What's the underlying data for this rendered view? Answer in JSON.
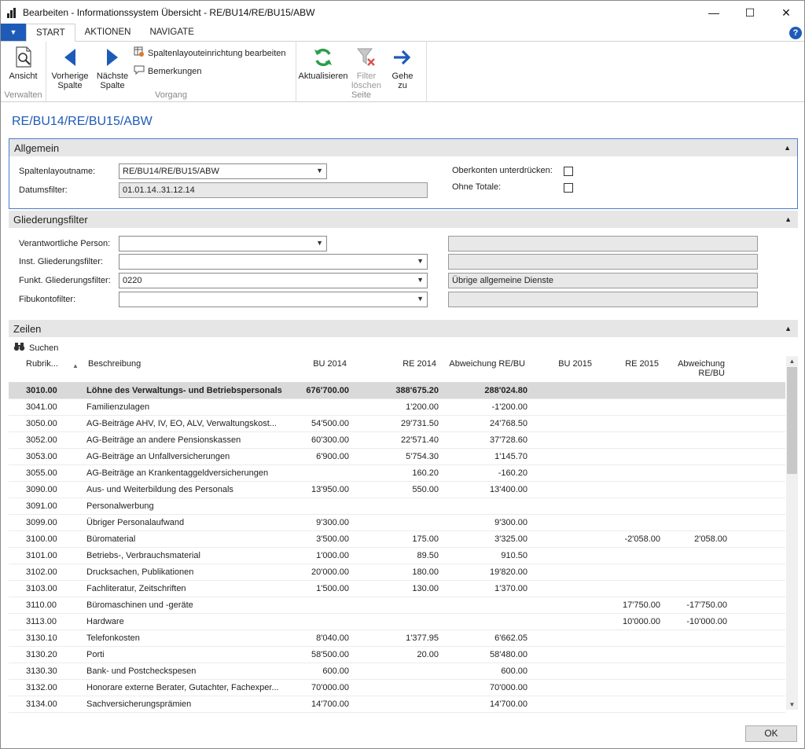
{
  "window": {
    "title": "Bearbeiten - Informationssystem Übersicht - RE/BU14/RE/BU15/ABW",
    "minimize": "—",
    "maximize": "☐",
    "close": "✕"
  },
  "ribbon": {
    "tabs": [
      "START",
      "AKTIONEN",
      "NAVIGATE"
    ],
    "help": "?",
    "groups": {
      "verwalten": {
        "label": "Verwalten",
        "ansicht": "Ansicht"
      },
      "vorgang": {
        "label": "Vorgang",
        "vorherige_l1": "Vorherige",
        "vorherige_l2": "Spalte",
        "naechste_l1": "Nächste",
        "naechste_l2": "Spalte",
        "spaltenlayout": "Spaltenlayouteinrichtung bearbeiten",
        "bemerkungen": "Bemerkungen"
      },
      "seite": {
        "label": "Seite",
        "aktualisieren": "Aktualisieren",
        "filter_l1": "Filter",
        "filter_l2": "löschen",
        "gehe_l1": "Gehe",
        "gehe_l2": "zu"
      }
    },
    "colors": {
      "accent": "#1e5bb8",
      "refresh": "#2a9d4a",
      "filter_x": "#d9534f"
    }
  },
  "page": {
    "title": "RE/BU14/RE/BU15/ABW"
  },
  "allgemein": {
    "header": "Allgemein",
    "spaltenlayoutname_label": "Spaltenlayoutname:",
    "spaltenlayoutname_value": "RE/BU14/RE/BU15/ABW",
    "datumsfilter_label": "Datumsfilter:",
    "datumsfilter_value": "01.01.14..31.12.14",
    "oberkonten_label": "Oberkonten unterdrücken:",
    "ohne_totale_label": "Ohne Totale:"
  },
  "gliederung": {
    "header": "Gliederungsfilter",
    "verantwortlich_label": "Verantwortliche Person:",
    "inst_label": "Inst. Gliederungsfilter:",
    "funkt_label": "Funkt. Gliederungsfilter:",
    "funkt_value": "0220",
    "funkt_desc": "Übrige allgemeine Dienste",
    "fibu_label": "Fibukontofilter:"
  },
  "zeilen": {
    "header": "Zeilen",
    "suchen": "Suchen",
    "columns": {
      "rubrik": "Rubrik...",
      "beschreibung": "Beschreibung",
      "bu2014": "BU 2014",
      "re2014": "RE 2014",
      "abw14": "Abweichung RE/BU",
      "bu2015": "BU 2015",
      "re2015": "RE 2015",
      "abw15_l1": "Abweichung",
      "abw15_l2": "RE/BU"
    },
    "rows": [
      [
        "3010.00",
        "Löhne des Verwaltungs- und Betriebspersonals",
        "676'700.00",
        "388'675.20",
        "288'024.80",
        "",
        "",
        ""
      ],
      [
        "3041.00",
        "Familienzulagen",
        "",
        "1'200.00",
        "-1'200.00",
        "",
        "",
        ""
      ],
      [
        "3050.00",
        "AG-Beiträge AHV, IV, EO, ALV, Verwaltungskost...",
        "54'500.00",
        "29'731.50",
        "24'768.50",
        "",
        "",
        ""
      ],
      [
        "3052.00",
        "AG-Beiträge an andere Pensionskassen",
        "60'300.00",
        "22'571.40",
        "37'728.60",
        "",
        "",
        ""
      ],
      [
        "3053.00",
        "AG-Beiträge an Unfallversicherungen",
        "6'900.00",
        "5'754.30",
        "1'145.70",
        "",
        "",
        ""
      ],
      [
        "3055.00",
        "AG-Beiträge an Krankentaggeldversicherungen",
        "",
        "160.20",
        "-160.20",
        "",
        "",
        ""
      ],
      [
        "3090.00",
        "Aus- und Weiterbildung des Personals",
        "13'950.00",
        "550.00",
        "13'400.00",
        "",
        "",
        ""
      ],
      [
        "3091.00",
        "Personalwerbung",
        "",
        "",
        "",
        "",
        "",
        ""
      ],
      [
        "3099.00",
        "Übriger Personalaufwand",
        "9'300.00",
        "",
        "9'300.00",
        "",
        "",
        ""
      ],
      [
        "3100.00",
        "Büromaterial",
        "3'500.00",
        "175.00",
        "3'325.00",
        "",
        "-2'058.00",
        "2'058.00"
      ],
      [
        "3101.00",
        "Betriebs-, Verbrauchsmaterial",
        "1'000.00",
        "89.50",
        "910.50",
        "",
        "",
        ""
      ],
      [
        "3102.00",
        "Drucksachen, Publikationen",
        "20'000.00",
        "180.00",
        "19'820.00",
        "",
        "",
        ""
      ],
      [
        "3103.00",
        "Fachliteratur, Zeitschriften",
        "1'500.00",
        "130.00",
        "1'370.00",
        "",
        "",
        ""
      ],
      [
        "3110.00",
        "Büromaschinen und -geräte",
        "",
        "",
        "",
        "",
        "17'750.00",
        "-17'750.00"
      ],
      [
        "3113.00",
        "Hardware",
        "",
        "",
        "",
        "",
        "10'000.00",
        "-10'000.00"
      ],
      [
        "3130.10",
        "Telefonkosten",
        "8'040.00",
        "1'377.95",
        "6'662.05",
        "",
        "",
        ""
      ],
      [
        "3130.20",
        "Porti",
        "58'500.00",
        "20.00",
        "58'480.00",
        "",
        "",
        ""
      ],
      [
        "3130.30",
        "Bank- und Postcheckspesen",
        "600.00",
        "",
        "600.00",
        "",
        "",
        ""
      ],
      [
        "3132.00",
        "Honorare externe Berater, Gutachter, Fachexper...",
        "70'000.00",
        "",
        "70'000.00",
        "",
        "",
        ""
      ],
      [
        "3134.00",
        "Sachversicherungsprämien",
        "14'700.00",
        "",
        "14'700.00",
        "",
        "",
        ""
      ]
    ]
  },
  "footer": {
    "ok": "OK"
  }
}
